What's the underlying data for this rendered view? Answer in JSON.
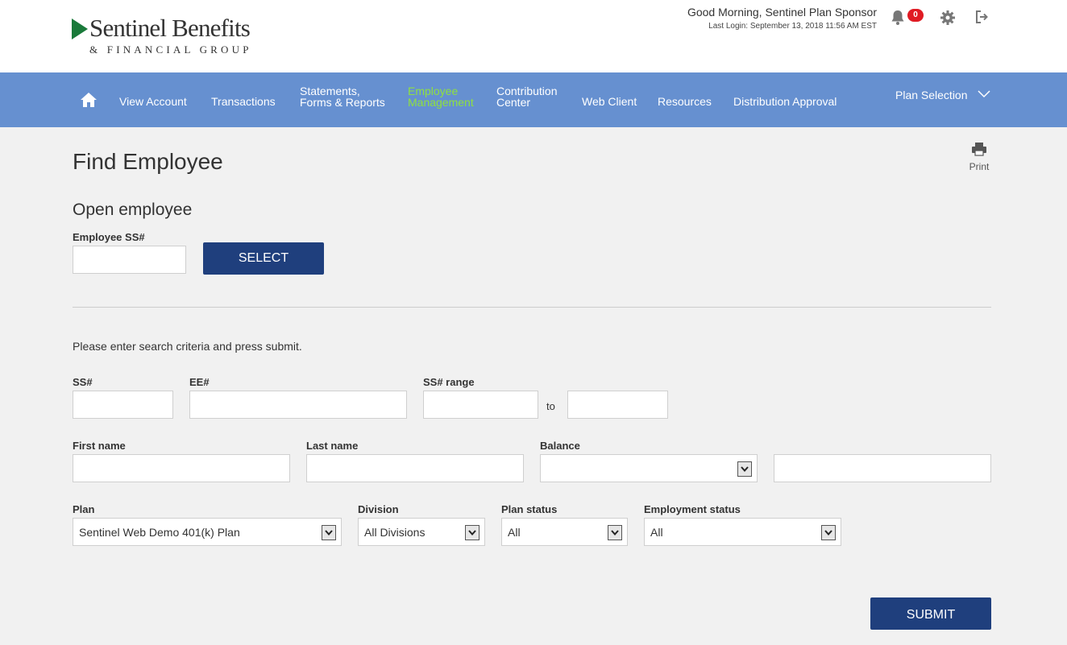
{
  "header": {
    "logo_name": "Sentinel Benefits",
    "logo_sub": "& FINANCIAL GROUP",
    "greeting": "Good Morning,  Sentinel Plan Sponsor",
    "last_login": "Last Login: September 13, 2018 11:56 AM EST",
    "notification_count": "0"
  },
  "nav": {
    "items": [
      {
        "label": "View Account"
      },
      {
        "label": "Transactions"
      },
      {
        "label_line1": "Statements,",
        "label_line2": "Forms & Reports"
      },
      {
        "label_line1": "Employee",
        "label_line2": "Management",
        "active": true
      },
      {
        "label_line1": "Contribution",
        "label_line2": "Center"
      },
      {
        "label": "Web Client"
      },
      {
        "label": "Resources"
      },
      {
        "label": "Distribution Approval"
      }
    ],
    "plan_selection": "Plan Selection"
  },
  "page": {
    "title": "Find Employee",
    "print_label": "Print"
  },
  "open_employee": {
    "heading": "Open employee",
    "ss_label": "Employee SS#",
    "ss_value": "",
    "select_button": "SELECT"
  },
  "search": {
    "instruction": "Please enter search criteria and press submit.",
    "ss_label": "SS#",
    "ss_value": "",
    "ee_label": "EE#",
    "ee_value": "",
    "ss_range_label": "SS# range",
    "ss_range_from": "",
    "ss_range_to_label": "to",
    "ss_range_to": "",
    "first_name_label": "First name",
    "first_name_value": "",
    "last_name_label": "Last name",
    "last_name_value": "",
    "balance_label": "Balance",
    "balance_operator": "",
    "balance_value": "",
    "plan_label": "Plan",
    "plan_value": "Sentinel Web Demo 401(k) Plan",
    "division_label": "Division",
    "division_value": "All Divisions",
    "plan_status_label": "Plan status",
    "plan_status_value": "All",
    "employment_status_label": "Employment status",
    "employment_status_value": "All",
    "submit_button": "SUBMIT"
  },
  "colors": {
    "nav_bg": "#6690d0",
    "nav_active": "#8fe040",
    "button_bg": "#1f3f7d",
    "badge_bg": "#e01b24",
    "logo_green": "#1a7a3a"
  }
}
